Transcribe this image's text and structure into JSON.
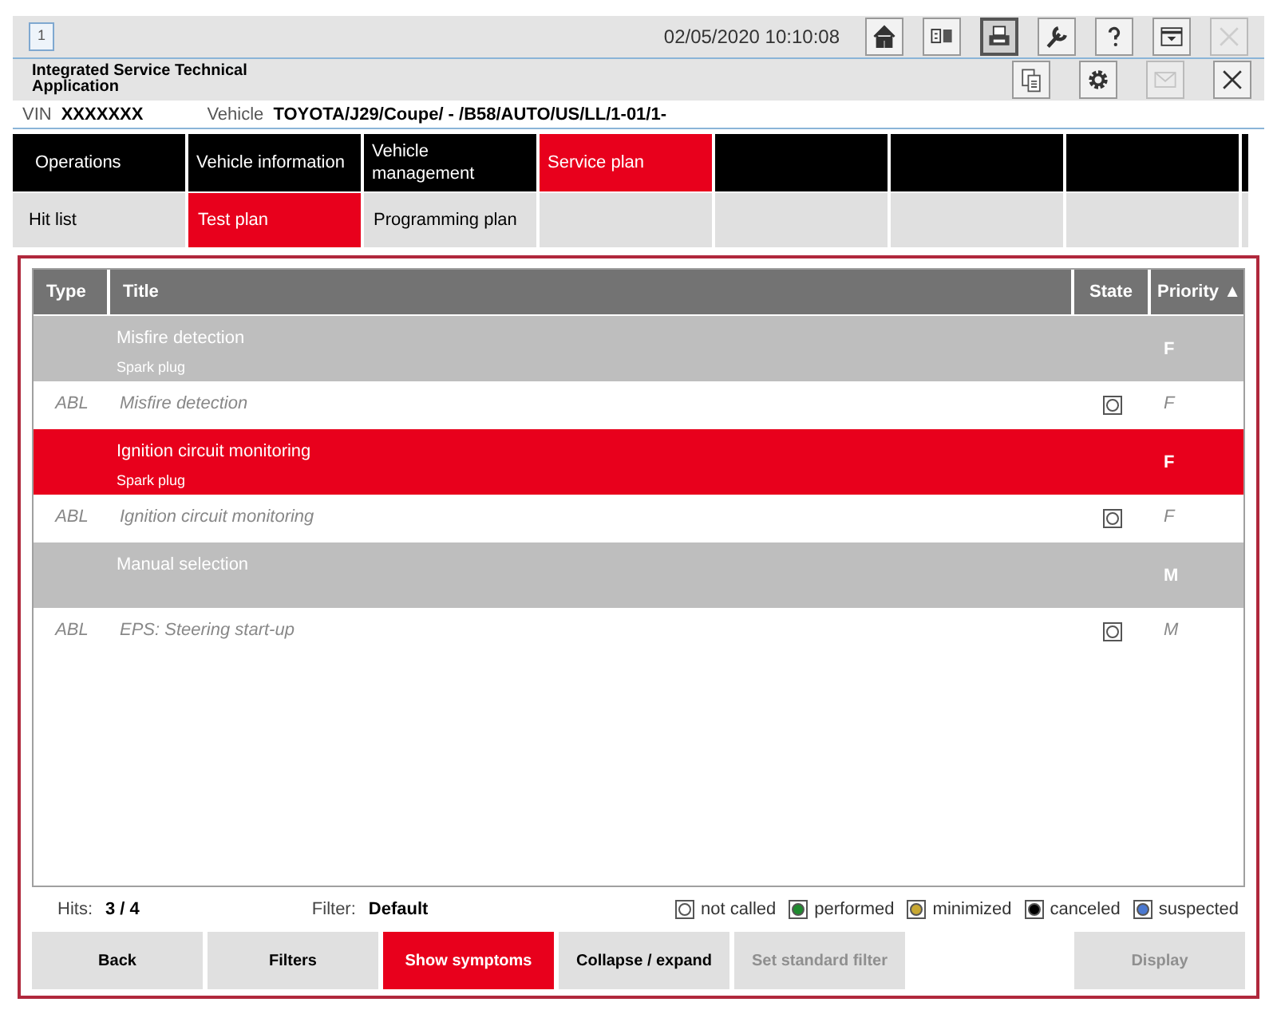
{
  "window": {
    "number": "1",
    "datetime": "02/05/2020 10:10:08",
    "title": "Integrated Service Technical Application"
  },
  "toolbar": [
    {
      "kind": "home",
      "selected": false,
      "disabled": false
    },
    {
      "kind": "panels",
      "selected": false,
      "disabled": false
    },
    {
      "kind": "printer",
      "selected": true,
      "disabled": false
    },
    {
      "kind": "wrench",
      "selected": false,
      "disabled": false
    },
    {
      "kind": "help",
      "selected": false,
      "disabled": false
    },
    {
      "kind": "tray",
      "selected": false,
      "disabled": false
    },
    {
      "kind": "close",
      "selected": false,
      "disabled": true
    }
  ],
  "app_toolbar": [
    {
      "kind": "documents",
      "disabled": false
    },
    {
      "kind": "gear",
      "disabled": false
    },
    {
      "kind": "mail",
      "disabled": true
    },
    {
      "kind": "close",
      "disabled": false
    }
  ],
  "vehicle_bar": {
    "vin_label": "VIN",
    "vin": "XXXXXXX",
    "vehicle_label": "Vehicle",
    "vehicle": "TOYOTA/J29/Coupe/ - /B58/AUTO/US/LL/1-01/1-"
  },
  "main_tabs": [
    {
      "label": "Operations",
      "selected": false
    },
    {
      "label": "Vehicle information",
      "selected": false
    },
    {
      "label": "Vehicle management",
      "selected": false
    },
    {
      "label": "Service plan",
      "selected": true
    }
  ],
  "sub_tabs": [
    {
      "label": "Hit list",
      "selected": false
    },
    {
      "label": "Test plan",
      "selected": true
    },
    {
      "label": "Programming plan",
      "selected": false
    }
  ],
  "table": {
    "columns": [
      "Type",
      "Title",
      "State",
      "Priority ▲"
    ],
    "rows": [
      {
        "kind": "group",
        "selected": false,
        "title": "Misfire detection",
        "subtitle": "Spark plug",
        "priority": "F"
      },
      {
        "kind": "item",
        "type": "ABL",
        "title": "Misfire detection",
        "color": "#ffffff",
        "priority": "F"
      },
      {
        "kind": "group",
        "selected": true,
        "title": "Ignition circuit monitoring",
        "subtitle": "Spark plug",
        "priority": "F"
      },
      {
        "kind": "item",
        "type": "ABL",
        "title": "Ignition circuit monitoring",
        "color": "#ffffff",
        "priority": "F"
      },
      {
        "kind": "group",
        "selected": false,
        "title": "Manual selection",
        "priority": "M"
      },
      {
        "kind": "item",
        "type": "ABL",
        "title": "EPS: Steering start-up",
        "color": "#ffffff",
        "priority": "M"
      }
    ]
  },
  "status": {
    "hits_label": "Hits:",
    "hits": "3 / 4",
    "filter_label": "Filter:",
    "filter": "Default"
  },
  "legend": [
    {
      "label": "not called",
      "color": "#ffffff"
    },
    {
      "label": "performed",
      "color": "#1e8a2e"
    },
    {
      "label": "minimized",
      "color": "#c8a832"
    },
    {
      "label": "canceled",
      "color": "#000000"
    },
    {
      "label": "suspected",
      "color": "#4a78d0"
    }
  ],
  "buttons": [
    {
      "label": "Back",
      "kind": "normal"
    },
    {
      "label": "Filters",
      "kind": "normal"
    },
    {
      "label": "Show symptoms",
      "kind": "highlighted"
    },
    {
      "label": "Collapse / expand",
      "kind": "normal"
    },
    {
      "label": "Set standard filter",
      "kind": "disabled"
    },
    {
      "label": "Display",
      "kind": "disabled"
    }
  ]
}
